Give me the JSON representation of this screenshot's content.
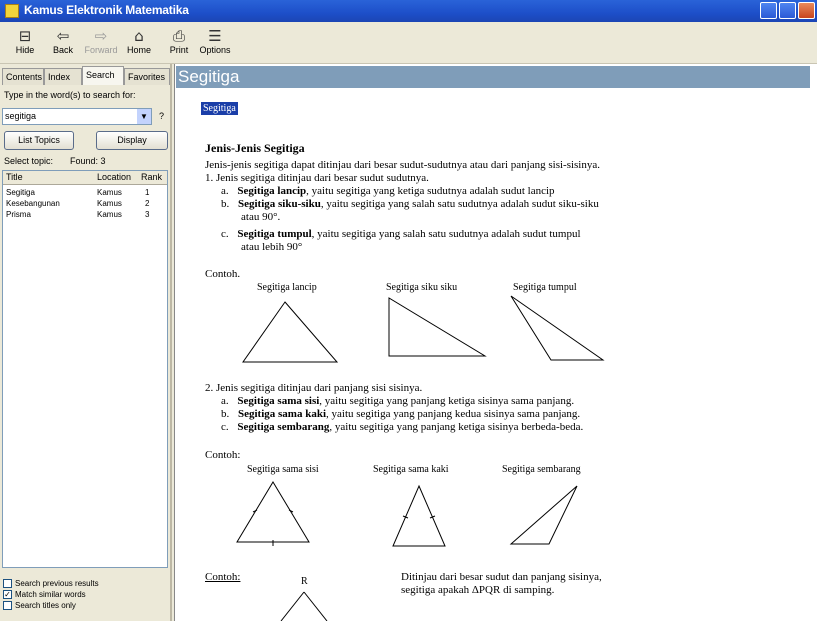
{
  "window": {
    "title": "Kamus Elektronik Matematika"
  },
  "toolbar": {
    "buttons": [
      {
        "label": "Hide",
        "icon": "hide-icon"
      },
      {
        "label": "Back",
        "icon": "back-arrow-icon"
      },
      {
        "label": "Forward",
        "icon": "forward-arrow-icon"
      },
      {
        "label": "Home",
        "icon": "home-icon"
      },
      {
        "label": "Print",
        "icon": "print-icon"
      },
      {
        "label": "Options",
        "icon": "options-icon"
      }
    ]
  },
  "sidebar": {
    "tabs": [
      "Contents",
      "Index",
      "Search",
      "Favorites"
    ],
    "prompt": "Type in the word(s) to search for:",
    "search_value": "segitiga",
    "help_button": "?",
    "list_topics_button": "List Topics",
    "display_button": "Display",
    "select_topic_label": "Select topic:",
    "found_label": "Found: 3",
    "columns": [
      "Title",
      "Location",
      "Rank"
    ],
    "rows": [
      {
        "title": "Segitiga",
        "location": "Kamus",
        "rank": "1"
      },
      {
        "title": "Kesebangunan",
        "location": "Kamus",
        "rank": "2"
      },
      {
        "title": "Prisma",
        "location": "Kamus",
        "rank": "3"
      }
    ],
    "checkboxes": [
      {
        "label": "Search previous results",
        "checked": false
      },
      {
        "label": "Match similar words",
        "checked": true
      },
      {
        "label": "Search titles only",
        "checked": false
      }
    ]
  },
  "content": {
    "topic_title": "Segitiga",
    "breadcrumb": "Segitiga",
    "heading": "Jenis-Jenis Segitiga",
    "intro": "Jenis-jenis segitiga dapat ditinjau dari besar sudut-sudutnya atau dari panjang sisi-sisinya.",
    "section1": {
      "title": "1.  Jenis segitiga ditinjau dari besar sudut sudutnya.",
      "items": [
        {
          "marker": "a.",
          "bold": "Segitiga lancip",
          "text": ", yaitu segitiga yang ketiga sudutnya adalah sudut lancip"
        },
        {
          "marker": "b.",
          "bold": "Segitiga siku-siku",
          "text": ", yaitu segitiga yang salah satu sudutnya adalah sudut siku-siku",
          "cont": "atau 90°."
        },
        {
          "marker": "c.",
          "bold": "Segitiga tumpul",
          "text": ", yaitu segitiga yang salah satu sudutnya adalah sudut tumpul",
          "cont": "atau lebih 90°"
        }
      ]
    },
    "example_label1": "Contoh.",
    "shapes1": [
      "Segitiga lancip",
      "Segitiga siku siku",
      "Segitiga tumpul"
    ],
    "section2": {
      "title": "2.  Jenis segitiga ditinjau dari panjang sisi sisinya.",
      "items": [
        {
          "marker": "a.",
          "bold": "Segitiga sama sisi",
          "text": ", yaitu segitiga yang panjang ketiga sisinya sama panjang."
        },
        {
          "marker": "b.",
          "bold": "Segitiga sama kaki",
          "text": ", yaitu segitiga yang panjang kedua sisinya sama panjang."
        },
        {
          "marker": "c.",
          "bold": "Segitiga sembarang",
          "text": ", yaitu segitiga yang panjang ketiga sisinya berbeda-beda."
        }
      ]
    },
    "example_label2": "Contoh:",
    "shapes2": [
      "Segitiga sama sisi",
      "Segitiga sama kaki",
      "Segitiga sembarang"
    ],
    "example_label3": "Contoh:",
    "vertex_label": "R",
    "question_line1": "Ditinjau dari besar sudut dan panjang sisinya,",
    "question_line2": "segitiga apakah ΔPQR di samping."
  }
}
